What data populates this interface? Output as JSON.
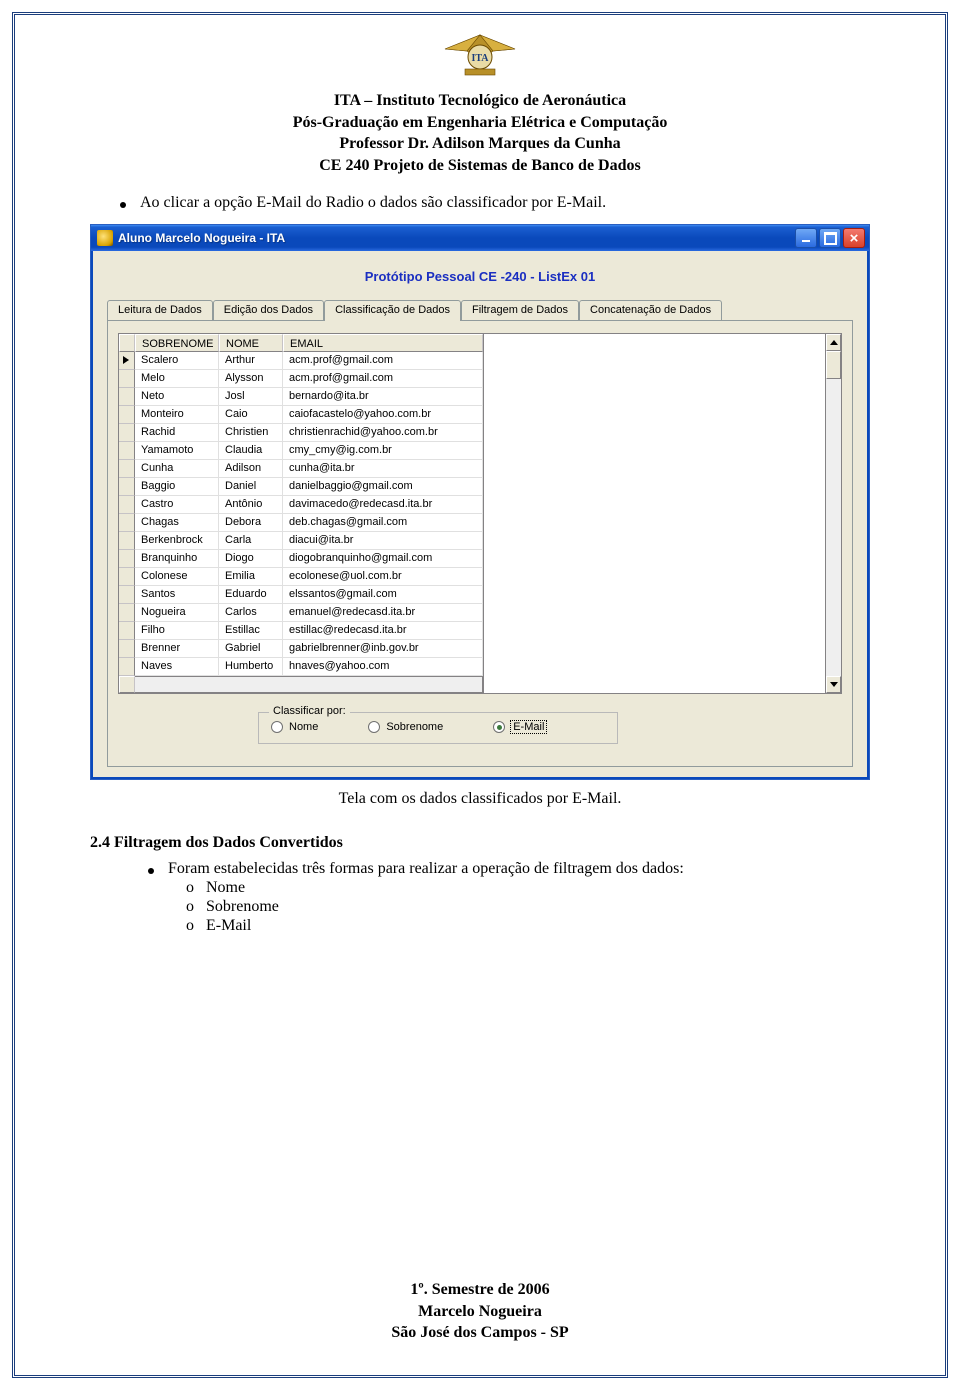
{
  "header": {
    "line1": "ITA – Instituto Tecnológico de Aeronáutica",
    "line2": "Pós-Graduação em Engenharia Elétrica e Computação",
    "line3": "Professor Dr. Adilson Marques da Cunha",
    "line4": "CE 240 Projeto de Sistemas de Banco de Dados"
  },
  "bullet1": "Ao clicar a opção E-Mail do Radio o dados são classificador por E-Mail.",
  "window": {
    "title": "Aluno Marcelo Nogueira - ITA",
    "prototype_title": "Protótipo Pessoal CE -240 - ListEx 01",
    "tabs": [
      "Leitura de Dados",
      "Edição dos Dados",
      "Classificação de Dados",
      "Filtragem de Dados",
      "Concatenação de Dados"
    ],
    "active_tab_index": 2,
    "columns": [
      "SOBRENOME",
      "NOME",
      "EMAIL"
    ],
    "rows": [
      {
        "sobrenome": "Scalero",
        "nome": "Arthur",
        "email": "acm.prof@gmail.com"
      },
      {
        "sobrenome": "Melo",
        "nome": "Alysson",
        "email": "acm.prof@gmail.com"
      },
      {
        "sobrenome": "Neto",
        "nome": "Josl",
        "email": "bernardo@ita.br"
      },
      {
        "sobrenome": "Monteiro",
        "nome": "Caio",
        "email": "caiofacastelo@yahoo.com.br"
      },
      {
        "sobrenome": "Rachid",
        "nome": "Christien",
        "email": "christienrachid@yahoo.com.br"
      },
      {
        "sobrenome": "Yamamoto",
        "nome": "Claudia",
        "email": "cmy_cmy@ig.com.br"
      },
      {
        "sobrenome": "Cunha",
        "nome": "Adilson",
        "email": "cunha@ita.br"
      },
      {
        "sobrenome": "Baggio",
        "nome": "Daniel",
        "email": "danielbaggio@gmail.com"
      },
      {
        "sobrenome": "Castro",
        "nome": "Antônio",
        "email": "davimacedo@redecasd.ita.br"
      },
      {
        "sobrenome": "Chagas",
        "nome": "Debora",
        "email": "deb.chagas@gmail.com"
      },
      {
        "sobrenome": "Berkenbrock",
        "nome": "Carla",
        "email": "diacui@ita.br"
      },
      {
        "sobrenome": "Branquinho",
        "nome": "Diogo",
        "email": "diogobranquinho@gmail.com"
      },
      {
        "sobrenome": "Colonese",
        "nome": "Emilia",
        "email": "ecolonese@uol.com.br"
      },
      {
        "sobrenome": "Santos",
        "nome": "Eduardo",
        "email": "elssantos@gmail.com"
      },
      {
        "sobrenome": "Nogueira",
        "nome": "Carlos",
        "email": "emanuel@redecasd.ita.br"
      },
      {
        "sobrenome": "Filho",
        "nome": "Estillac",
        "email": "estillac@redecasd.ita.br"
      },
      {
        "sobrenome": "Brenner",
        "nome": "Gabriel",
        "email": "gabrielbrenner@inb.gov.br"
      },
      {
        "sobrenome": "Naves",
        "nome": "Humberto",
        "email": "hnaves@yahoo.com"
      }
    ],
    "group_legend": "Classificar por:",
    "radio_options": [
      "Nome",
      "Sobrenome",
      "E-Mail"
    ],
    "radio_selected_index": 2
  },
  "caption": "Tela com os dados classificados por E-Mail.",
  "section_heading": "2.4 Filtragem dos Dados Convertidos",
  "bullet2": "Foram estabelecidas três formas para realizar a operação de filtragem dos dados:",
  "sub_items": [
    "Nome",
    "Sobrenome",
    "E-Mail"
  ],
  "footer": {
    "line1": "1º. Semestre de 2006",
    "line2": "Marcelo Nogueira",
    "line3": "São José dos Campos - SP"
  }
}
